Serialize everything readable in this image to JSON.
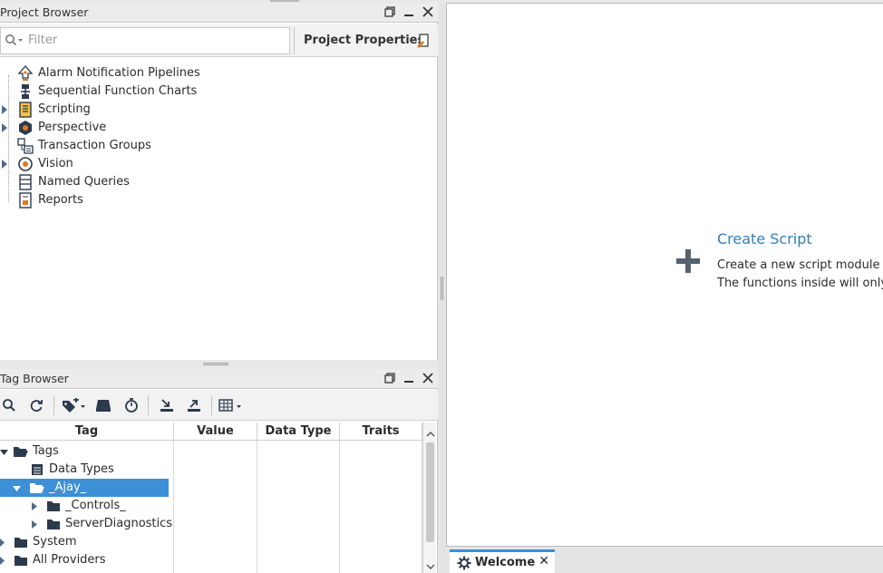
{
  "project_browser": {
    "title": "Project Browser",
    "filter_placeholder": "Filter",
    "project_properties_label": "Project Properties",
    "items": [
      {
        "label": "Alarm Notification Pipelines",
        "expandable": false,
        "icon": "alarm-pipeline-icon"
      },
      {
        "label": "Sequential Function Charts",
        "expandable": false,
        "icon": "sfc-icon"
      },
      {
        "label": "Scripting",
        "expandable": true,
        "icon": "script-icon"
      },
      {
        "label": "Perspective",
        "expandable": true,
        "icon": "perspective-icon"
      },
      {
        "label": "Transaction Groups",
        "expandable": false,
        "icon": "transaction-group-icon"
      },
      {
        "label": "Vision",
        "expandable": true,
        "icon": "vision-icon"
      },
      {
        "label": "Named Queries",
        "expandable": false,
        "icon": "named-query-icon"
      },
      {
        "label": "Reports",
        "expandable": false,
        "icon": "report-icon"
      }
    ]
  },
  "tag_browser": {
    "title": "Tag Browser",
    "columns": [
      "Tag",
      "Value",
      "Data Type",
      "Traits"
    ],
    "rows": [
      {
        "label": "Tags",
        "level": 0,
        "expanded": true,
        "icon": "folder-open-icon",
        "selected": false
      },
      {
        "label": "Data Types",
        "level": 1,
        "expanded": false,
        "icon": "data-types-icon",
        "selected": false
      },
      {
        "label": "_Ajay_",
        "level": 0,
        "expanded": true,
        "icon": "folder-open-icon",
        "selected": true
      },
      {
        "label": "_Controls_",
        "level": 1,
        "expanded": false,
        "icon": "folder-icon",
        "selected": false
      },
      {
        "label": "ServerDiagnostics",
        "level": 1,
        "expanded": false,
        "icon": "folder-icon",
        "selected": false
      },
      {
        "label": "System",
        "level": 0,
        "expanded": false,
        "icon": "folder-icon",
        "selected": false
      },
      {
        "label": "All Providers",
        "level": 0,
        "expanded": false,
        "icon": "folder-icon",
        "selected": false
      }
    ]
  },
  "editor": {
    "create_title": "Create Script",
    "create_desc_line1": "Create a new script module u",
    "create_desc_line2": "The functions inside will only"
  },
  "tabs": [
    {
      "label": "Welcome",
      "close": "✕"
    }
  ],
  "colors": {
    "accent": "#3d8fd6",
    "link": "#2d7fbd"
  }
}
